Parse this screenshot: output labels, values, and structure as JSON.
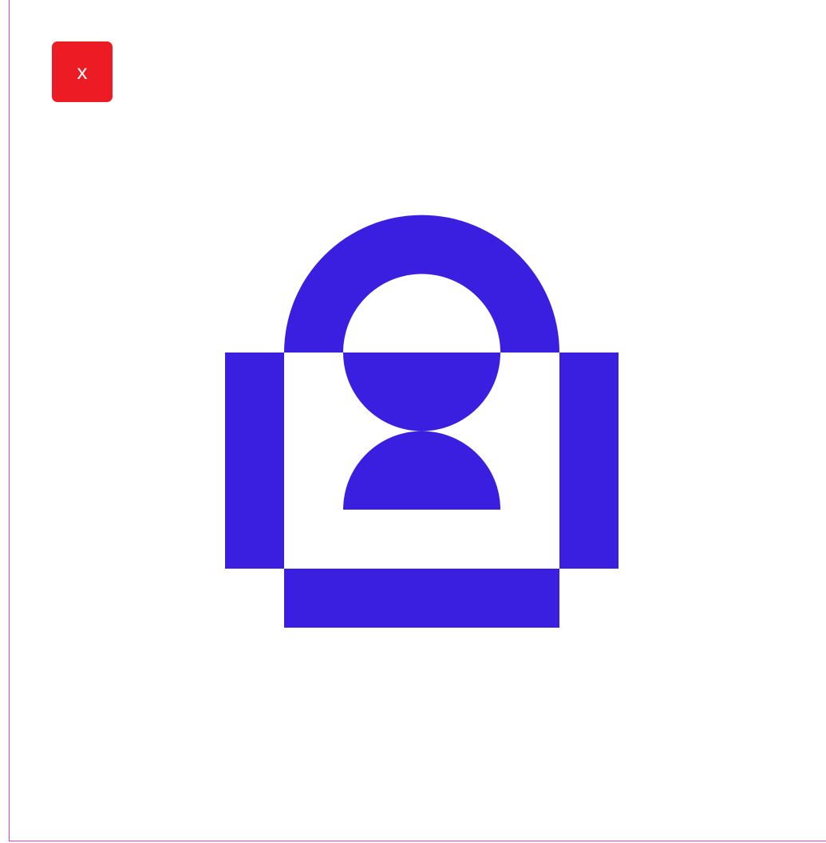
{
  "close_button": {
    "label": "x",
    "color": "#ed1c24"
  },
  "illustration": {
    "icon": "lock-user-icon",
    "color": "#3a1fe0"
  },
  "frame_color": "#e040c8"
}
